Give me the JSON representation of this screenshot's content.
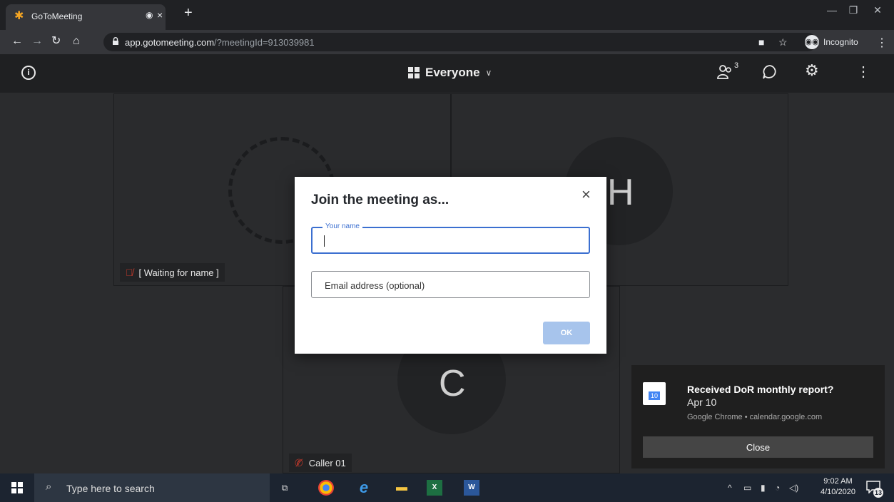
{
  "browser": {
    "tab_title": "GoToMeeting",
    "url_host": "app.gotomeeting.com",
    "url_path": "/?meetingId=913039981",
    "incognito_label": "Incognito"
  },
  "meeting": {
    "view_label": "Everyone",
    "participant_count": "3",
    "tiles": [
      {
        "name": "[ Waiting for name ]"
      },
      {
        "letter": "H"
      },
      {
        "letter": "C",
        "name": "Caller 01"
      }
    ]
  },
  "dialog": {
    "title": "Join the meeting as...",
    "name_label": "Your name",
    "name_value": "",
    "email_placeholder": "Email address (optional)",
    "ok_label": "OK"
  },
  "notification": {
    "calendar_day": "10",
    "title": "Received DoR monthly report?",
    "date": "Apr 10",
    "source": "Google Chrome • calendar.google.com",
    "close_label": "Close"
  },
  "taskbar": {
    "search_placeholder": "Type here to search",
    "time": "9:02 AM",
    "date": "4/10/2020",
    "notification_count": "13"
  },
  "colors": {
    "accent": "#3b6fd0",
    "ok_disabled": "#a7c4ec",
    "muted_mic": "#c0392b"
  }
}
